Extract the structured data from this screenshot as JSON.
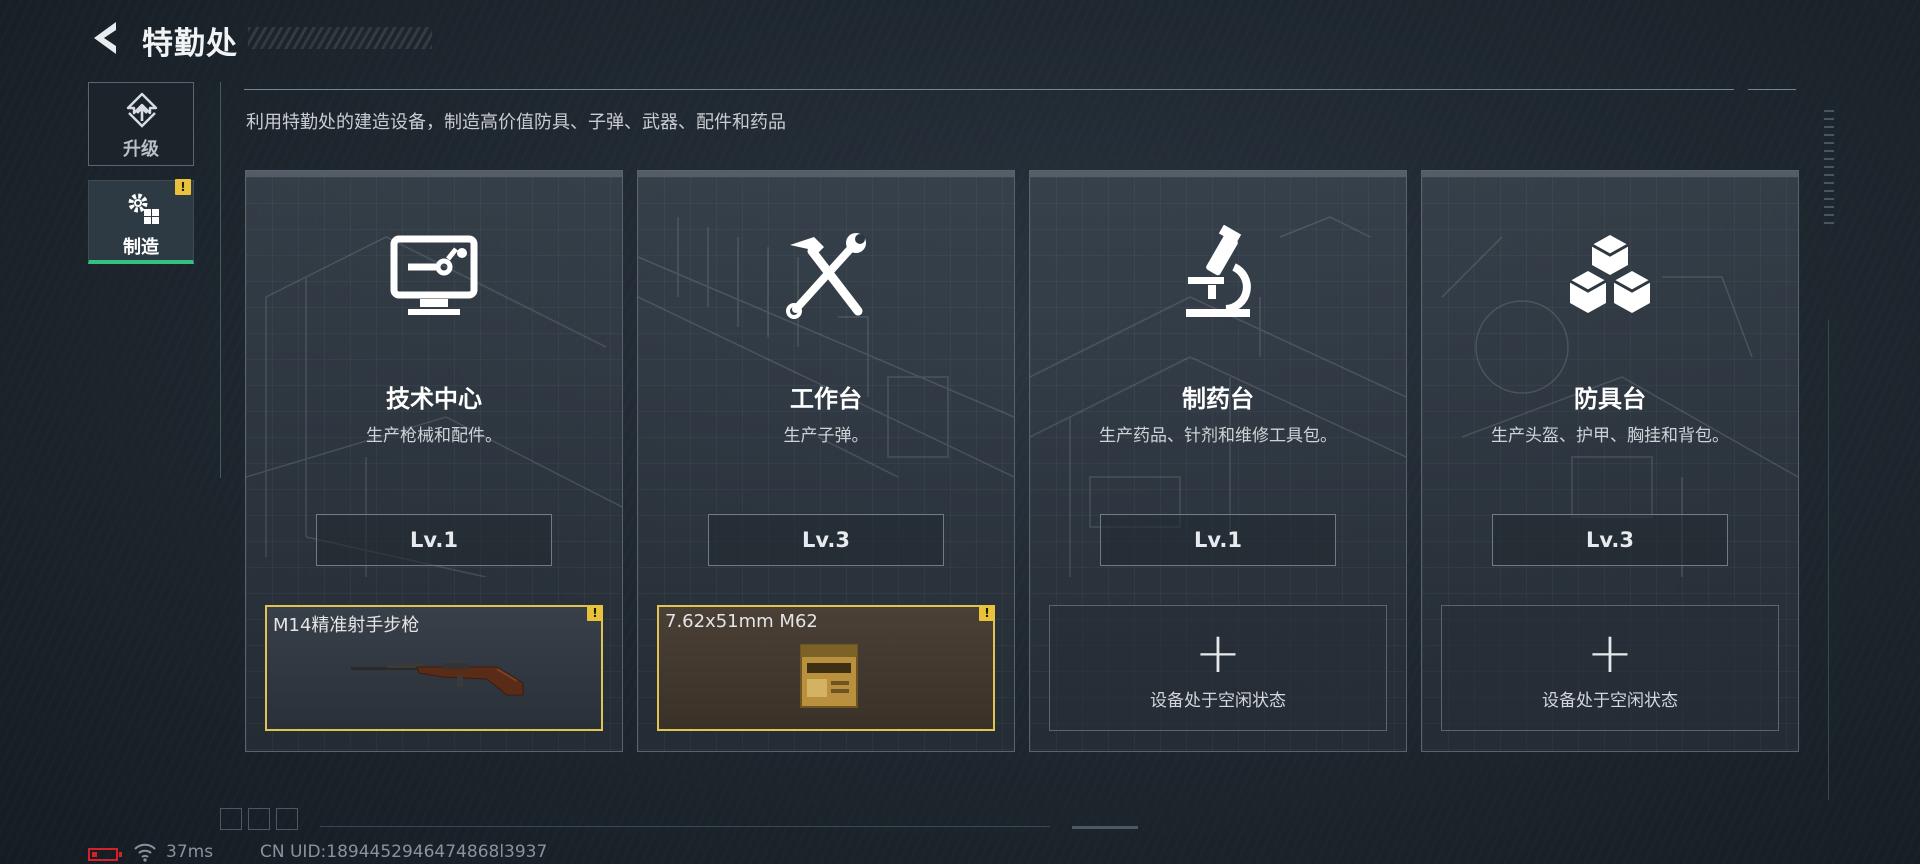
{
  "header": {
    "title": "特勤处",
    "back_icon": "back-arrow-icon"
  },
  "subtitle": "利用特勤处的建造设备，制造高价值防具、子弹、武器、配件和药品",
  "side_tabs": [
    {
      "label": "升级",
      "icon": "upgrade-icon",
      "active": false,
      "alert": false
    },
    {
      "label": "制造",
      "icon": "craft-gears-icon",
      "active": true,
      "alert": true,
      "alert_text": "!"
    }
  ],
  "stations": [
    {
      "name": "技术中心",
      "desc": "生产枪械和配件。",
      "level": "Lv.1",
      "icon": "monitor-icon",
      "slot": {
        "status": "active",
        "item": "M14精准射手步枪",
        "alert": "!"
      }
    },
    {
      "name": "工作台",
      "desc": "生产子弹。",
      "level": "Lv.3",
      "icon": "hammer-wrench-icon",
      "slot": {
        "status": "active",
        "item": "7.62x51mm M62",
        "alert": "!"
      }
    },
    {
      "name": "制药台",
      "desc": "生产药品、针剂和维修工具包。",
      "level": "Lv.1",
      "icon": "microscope-icon",
      "slot": {
        "status": "idle",
        "plus": "+",
        "idle_text": "设备处于空闲状态"
      }
    },
    {
      "name": "防具台",
      "desc": "生产头盔、护甲、胸挂和背包。",
      "level": "Lv.3",
      "icon": "cubes-icon",
      "slot": {
        "status": "idle",
        "plus": "+",
        "idle_text": "设备处于空闲状态"
      }
    }
  ],
  "status_bar": {
    "ping": "37ms",
    "uid": "CN UID:1894452946474868l3937"
  },
  "colors": {
    "accent_green": "#35c27f",
    "alert_yellow": "#e9c23c",
    "battery_red": "#d3222a"
  }
}
